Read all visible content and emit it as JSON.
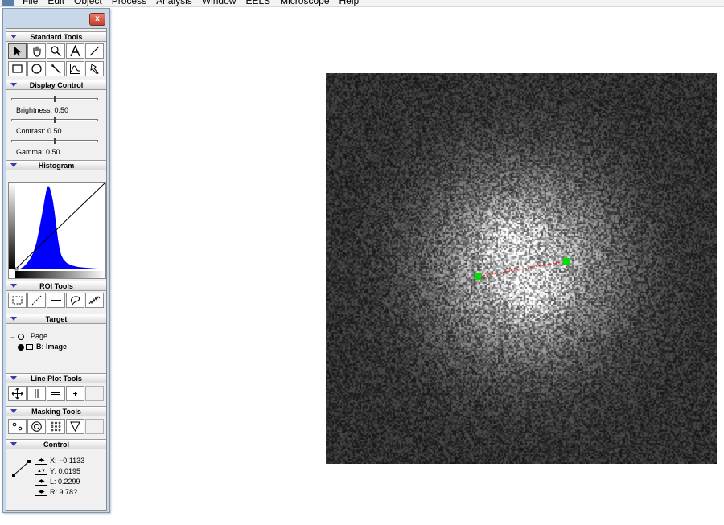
{
  "menubar": {
    "items": [
      "File",
      "Edit",
      "Object",
      "Process",
      "Analysis",
      "Window",
      "EELS",
      "Microscope",
      "Help"
    ]
  },
  "palette": {
    "close_label": "x",
    "sections": {
      "standard_tools": "Standard Tools",
      "display_control": "Display Control",
      "histogram": "Histogram",
      "roi_tools": "ROI Tools",
      "target": "Target",
      "line_plot_tools": "Line Plot Tools",
      "masking_tools": "Masking Tools",
      "control": "Control"
    },
    "display_control": {
      "brightness_label": "Brightness: 0.50",
      "contrast_label": "Contrast: 0.50",
      "gamma_label": "Gamma: 0.50",
      "brightness": 0.5,
      "contrast": 0.5,
      "gamma": 0.5
    },
    "target": {
      "page_label": "Page",
      "image_label": "B: Image"
    },
    "control": {
      "x": "X: −0.1133",
      "y": "Y: 0.0195",
      "l": "L: 0.2299",
      "r": "R: 9.78?"
    }
  },
  "colors": {
    "histogram_fill": "#0000ff",
    "roi_endpoint": "#00e000",
    "roi_line": "#ff2020",
    "palette_frame": "#c8d8e8"
  },
  "icons": {
    "standard_tools": [
      "arrow-pointer-icon",
      "hand-icon",
      "magnifier-icon",
      "text-tool-icon",
      "line-tool-icon",
      "rectangle-tool-icon",
      "oval-tool-icon",
      "magic-wand-icon",
      "profile-tool-icon",
      "wand-cursor-icon"
    ],
    "roi_tools": [
      "rect-roi-icon",
      "line-roi-icon",
      "point-roi-icon",
      "lasso-roi-icon",
      "freehand-roi-icon"
    ],
    "line_plot_tools": [
      "move-crosshair-icon",
      "vertical-marker-icon",
      "horizontal-marker-icon",
      "point-marker-icon"
    ],
    "masking_tools": [
      "point-mask-icon",
      "ring-mask-icon",
      "array-mask-icon",
      "wedge-mask-icon"
    ]
  }
}
